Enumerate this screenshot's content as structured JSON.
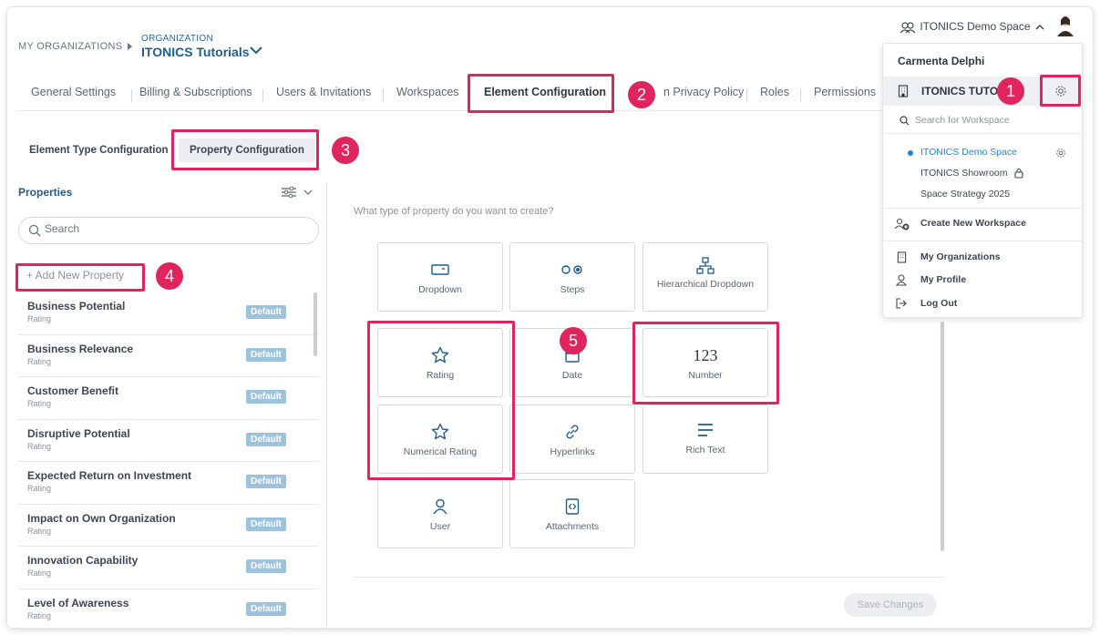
{
  "breadcrumb": {
    "root": "MY ORGANIZATIONS",
    "org_label": "ORGANIZATION",
    "org_name": "ITONICS Tutorials"
  },
  "workspace_switcher": {
    "label": "ITONICS Demo Space"
  },
  "tabs": [
    {
      "label": "General Settings"
    },
    {
      "label": "Billing & Subscriptions"
    },
    {
      "label": "Users & Invitations"
    },
    {
      "label": "Workspaces"
    },
    {
      "label": "Element Configuration",
      "active": true
    },
    {
      "label": "n Privacy Policy"
    },
    {
      "label": "Roles"
    },
    {
      "label": "Permissions"
    }
  ],
  "subtabs": {
    "element_type": "Element Type Configuration",
    "property": "Property Configuration"
  },
  "properties_panel": {
    "title": "Properties",
    "search_placeholder": "Search",
    "add_label": "+ Add New Property",
    "items": [
      {
        "name": "Business Potential",
        "type": "Rating",
        "badge": "Default"
      },
      {
        "name": "Business Relevance",
        "type": "Rating",
        "badge": "Default"
      },
      {
        "name": "Customer Benefit",
        "type": "Rating",
        "badge": "Default"
      },
      {
        "name": "Disruptive Potential",
        "type": "Rating",
        "badge": "Default"
      },
      {
        "name": "Expected Return on Investment",
        "type": "Rating",
        "badge": "Default"
      },
      {
        "name": "Impact on Own Organization",
        "type": "Rating",
        "badge": "Default"
      },
      {
        "name": "Innovation Capability",
        "type": "Rating",
        "badge": "Default"
      },
      {
        "name": "Level of Awareness",
        "type": "Rating",
        "badge": "Default"
      }
    ]
  },
  "creator": {
    "question": "What type of property do you want to create?",
    "types": [
      {
        "label": "Dropdown",
        "icon": "dropdown-icon"
      },
      {
        "label": "Steps",
        "icon": "steps-icon"
      },
      {
        "label": "Hierarchical Dropdown",
        "icon": "hierarchy-icon"
      },
      {
        "label": "Rating",
        "icon": "star-icon"
      },
      {
        "label": "Date",
        "icon": "calendar-icon"
      },
      {
        "label": "Number",
        "icon": "number-icon",
        "glyph": "123"
      },
      {
        "label": "Numerical Rating",
        "icon": "star-icon"
      },
      {
        "label": "Hyperlinks",
        "icon": "link-icon"
      },
      {
        "label": "Rich Text",
        "icon": "text-lines-icon"
      },
      {
        "label": "User",
        "icon": "user-icon"
      },
      {
        "label": "Attachments",
        "icon": "attachment-icon"
      }
    ],
    "save_label": "Save Changes"
  },
  "menu": {
    "user_name": "Carmenta Delphi",
    "org_name": "ITONICS TUTORI",
    "search_placeholder": "Search for Workspace",
    "workspaces": [
      {
        "name": "ITONICS Demo Space",
        "active": true
      },
      {
        "name": "ITONICS Showroom"
      },
      {
        "name": "Space Strategy 2025"
      }
    ],
    "create_label": "Create New Workspace",
    "links": [
      "My Organizations",
      "My Profile",
      "Log Out"
    ]
  },
  "steps": [
    "1",
    "2",
    "3",
    "4",
    "5"
  ],
  "colors": {
    "accent": "#e0245e",
    "brand": "#1d5d91",
    "badge": "#9cc3dd"
  }
}
